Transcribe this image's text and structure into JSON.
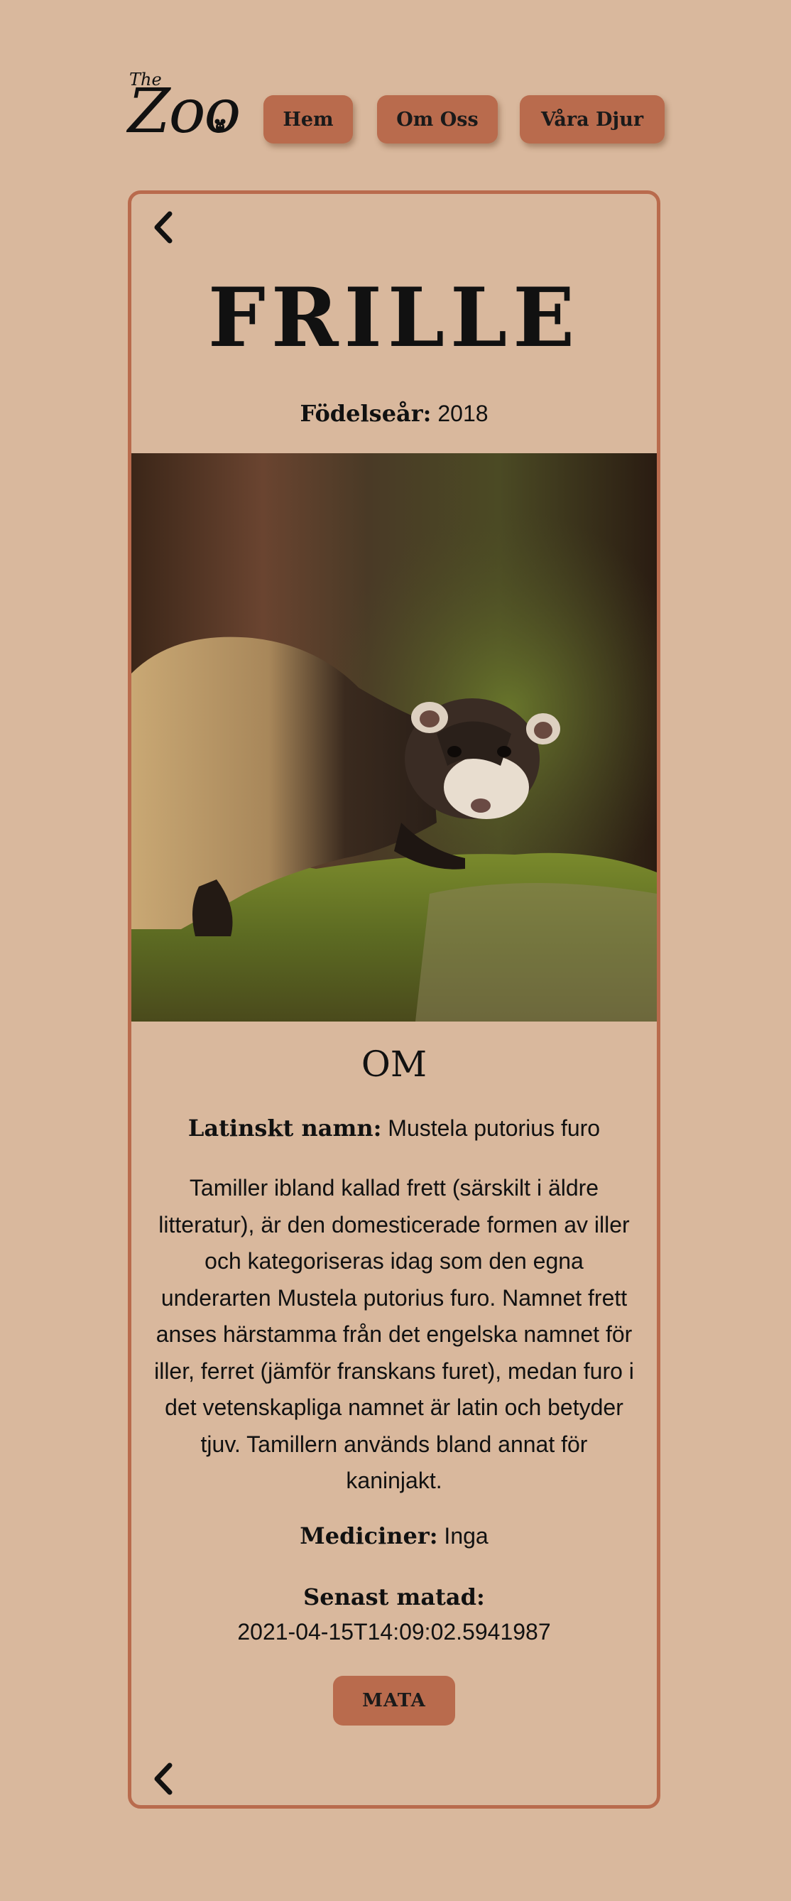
{
  "logo": {
    "the": "The",
    "name": "Zoo"
  },
  "nav": {
    "home": "Hem",
    "about": "Om Oss",
    "animals": "Våra Djur"
  },
  "animal": {
    "name": "FRILLE",
    "birth_label": "Födelseår:",
    "birth_year": "2018",
    "about_heading": "OM",
    "latin_label": "Latinskt namn:",
    "latin_name": "Mustela putorius furo",
    "description": "Tamiller ibland kallad frett (särskilt i äldre litteratur), är den domesticerade formen av iller och kategoriseras idag som den egna underarten Mustela putorius furo. Namnet frett anses härstamma från det engelska namnet för iller, ferret (jämför franskans furet), medan furo i det vetenskapliga namnet är latin och betyder tjuv. Tamillern används bland annat för kaninjakt.",
    "medicine_label": "Mediciner:",
    "medicine": "Inga",
    "fed_label": "Senast matad:",
    "fed_at": "2021-04-15T14:09:02.5941987",
    "feed_button": "MATA"
  },
  "colors": {
    "background": "#d9b89d",
    "accent": "#b96b4d"
  },
  "icons": {
    "back": "chevron-left-icon",
    "mascot": "mouse-icon"
  }
}
